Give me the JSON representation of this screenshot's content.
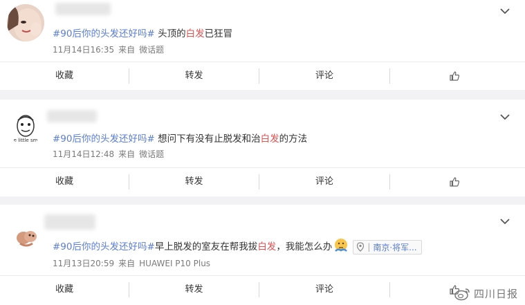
{
  "feed": [
    {
      "hashtag": "#90后你的头发还好吗#",
      "text_before": " 头顶的",
      "highlight": "白发",
      "text_after": "已狂冒",
      "time": "11月14日16:35",
      "from_prefix": "来自",
      "source": "微话题",
      "location": ""
    },
    {
      "hashtag": "#90后你的头发还好吗#",
      "text_before": " 想问下有没有止脱发和治",
      "highlight": "白发",
      "text_after": "的方法",
      "time": "11月14日12:48",
      "from_prefix": "来自",
      "source": "微话题",
      "avatar_text": "e little sm",
      "location": ""
    },
    {
      "hashtag": "#90后你的头发还好吗#",
      "text_before": "早上脱发的室友在帮我拔",
      "highlight": "白发",
      "text_after": "，我能怎么办",
      "time": "11月13日20:59",
      "from_prefix": "来自",
      "source": "HUAWEI P10 Plus",
      "location": "南京·将军..."
    }
  ],
  "actions": {
    "favorite": "收藏",
    "repost": "转发",
    "comment": "评论"
  },
  "watermark": "四川日报",
  "colors": {
    "hashtag": "#5a7dd8",
    "highlight": "#e35050",
    "background": "#f2f2f5"
  }
}
